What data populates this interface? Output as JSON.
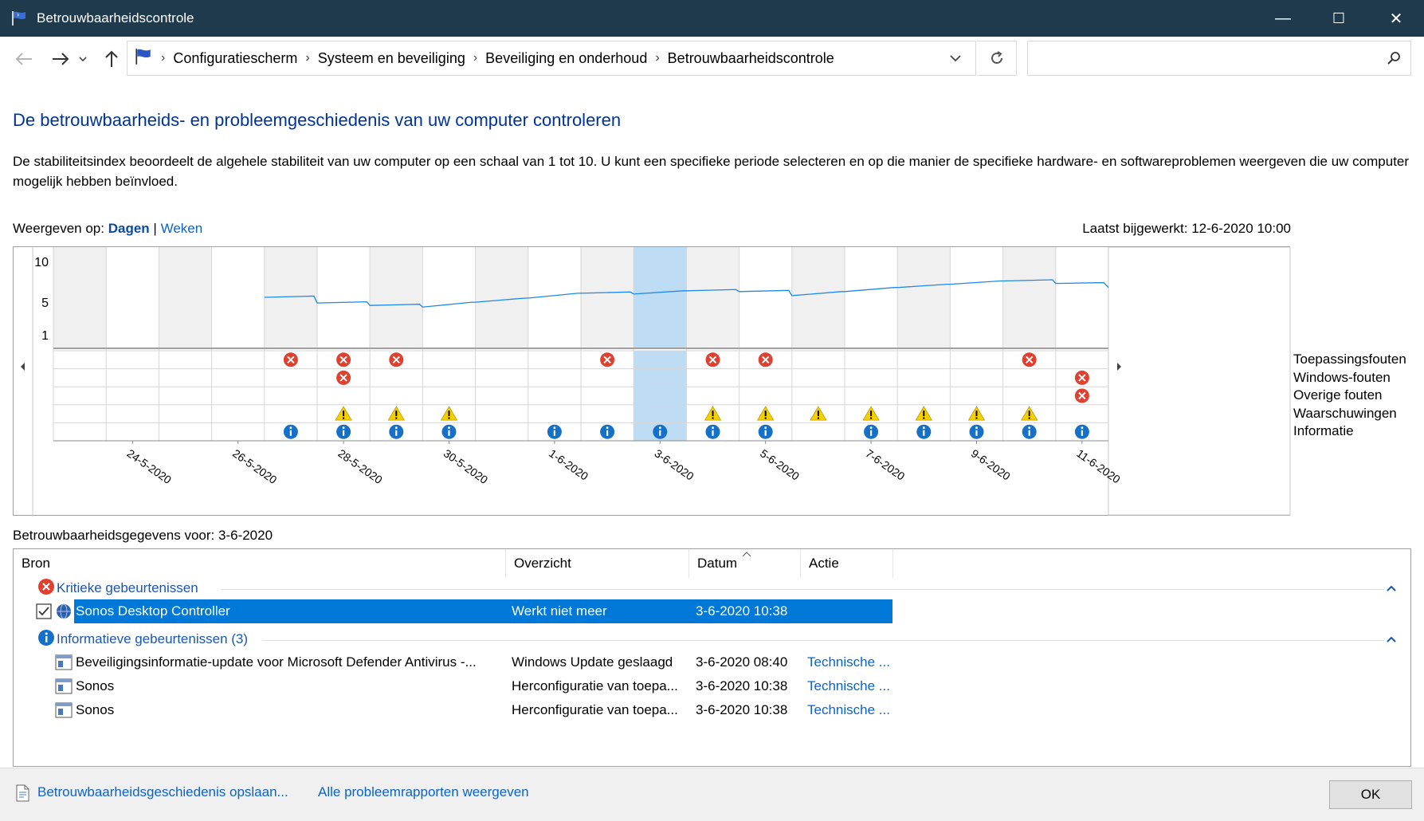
{
  "window": {
    "title": "Betrouwbaarheidscontrole",
    "minimize": "—",
    "maximize": "☐",
    "close": "✕"
  },
  "nav": {
    "breadcrumbs": [
      "Configuratiescherm",
      "Systeem en beveiliging",
      "Beveiliging en onderhoud",
      "Betrouwbaarheidscontrole"
    ],
    "search_placeholder": ""
  },
  "page": {
    "heading": "De betrouwbaarheids- en probleemgeschiedenis van uw computer controleren",
    "description": "De stabiliteitsindex beoordeelt de algehele stabiliteit van uw computer op een schaal van 1 tot 10. U kunt een specifieke periode selecteren en op die manier de specifieke hardware- en softwareproblemen weergeven die uw computer mogelijk hebben beïnvloed.",
    "view_label": "Weergeven op:",
    "view_days": "Dagen",
    "view_separator": "|",
    "view_weeks": "Weken",
    "last_updated": "Laatst bijgewerkt: 12-6-2020 10:00"
  },
  "chart_data": {
    "type": "line",
    "y_ticks": [
      "10",
      "5",
      "1"
    ],
    "ylim": [
      1,
      10
    ],
    "x_labels": [
      "24-5-2020",
      "26-5-2020",
      "28-5-2020",
      "30-5-2020",
      "1-6-2020",
      "3-6-2020",
      "5-6-2020",
      "7-6-2020",
      "9-6-2020",
      "11-6-2020"
    ],
    "days": [
      "23-5",
      "24-5",
      "25-5",
      "26-5",
      "27-5",
      "28-5",
      "29-5",
      "30-5",
      "31-5",
      "1-6",
      "2-6",
      "3-6",
      "4-6",
      "5-6",
      "6-6",
      "7-6",
      "8-6",
      "9-6",
      "10-6",
      "11-6"
    ],
    "selected_day": "3-6",
    "stability": [
      null,
      null,
      null,
      null,
      5.6,
      4.9,
      4.6,
      4.4,
      5.0,
      5.5,
      6.1,
      6.0,
      6.4,
      6.3,
      5.8,
      6.3,
      6.8,
      7.2,
      7.6,
      7.3
    ],
    "legend": [
      "Toepassingsfouten",
      "Windows-fouten",
      "Overige fouten",
      "Waarschuwingen",
      "Informatie"
    ],
    "events": {
      "Toepassingsfouten": [
        "27-5",
        "28-5",
        "29-5",
        "2-6",
        "4-6",
        "5-6",
        "10-6"
      ],
      "Windows-fouten": [
        "28-5",
        "11-6"
      ],
      "Overige fouten": [
        "11-6"
      ],
      "Waarschuwingen": [
        "28-5",
        "29-5",
        "30-5",
        "4-6",
        "5-6",
        "6-6",
        "7-6",
        "8-6",
        "9-6",
        "10-6"
      ],
      "Informatie": [
        "27-5",
        "28-5",
        "29-5",
        "30-5",
        "1-6",
        "2-6",
        "3-6",
        "4-6",
        "5-6",
        "7-6",
        "8-6",
        "9-6",
        "10-6",
        "11-6"
      ]
    },
    "colors": {
      "line": "#1e88e5",
      "selected": "#bfdcf5",
      "shaded": "#f0f0f0",
      "error": "#e0402f",
      "warning": "#f5d000",
      "info": "#1570c8"
    }
  },
  "details": {
    "title": "Betrouwbaarheidsgegevens voor: 3-6-2020",
    "columns": [
      "Bron",
      "Overzicht",
      "Datum",
      "Actie"
    ],
    "groups": [
      {
        "label": "Kritieke gebeurtenissen",
        "rows": [
          {
            "source": "Sonos Desktop Controller",
            "summary": "Werkt niet meer",
            "date": "3-6-2020 10:38",
            "action": ""
          }
        ]
      },
      {
        "label": "Informatieve gebeurtenissen (3)",
        "rows": [
          {
            "source": "Beveiligingsinformatie-update voor Microsoft Defender Antivirus -...",
            "summary": "Windows Update geslaagd",
            "date": "3-6-2020 08:40",
            "action": "Technische ..."
          },
          {
            "source": "Sonos",
            "summary": "Herconfiguratie van toepa...",
            "date": "3-6-2020 10:38",
            "action": "Technische ..."
          },
          {
            "source": "Sonos",
            "summary": "Herconfiguratie van toepa...",
            "date": "3-6-2020 10:38",
            "action": "Technische ..."
          }
        ]
      }
    ]
  },
  "footer": {
    "save_link": "Betrouwbaarheidsgeschiedenis opslaan...",
    "reports_link": "Alle probleemrapporten weergeven",
    "ok": "OK"
  }
}
